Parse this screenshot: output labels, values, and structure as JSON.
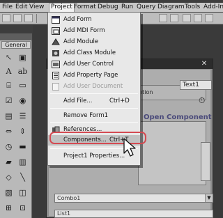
{
  "menubar": {
    "items": [
      {
        "label": "File"
      },
      {
        "label": "Edit"
      },
      {
        "label": "View"
      },
      {
        "label": "Project"
      },
      {
        "label": "Format"
      },
      {
        "label": "Debug"
      },
      {
        "label": "Run"
      },
      {
        "label": "Query"
      },
      {
        "label": "Diagram"
      },
      {
        "label": "Tools"
      },
      {
        "label": "Add-Ins"
      }
    ],
    "active": "Project"
  },
  "toolbox": {
    "tab_label": "General"
  },
  "form": {
    "text1": "Text1",
    "option_label": "ption",
    "heading": "Open Component",
    "combo1": "Combo1",
    "list1": "List1"
  },
  "project_menu": {
    "items": [
      {
        "label": "Add Form",
        "icon": "form-icon"
      },
      {
        "label": "Add MDI Form",
        "icon": "mdi-form-icon"
      },
      {
        "label": "Add Module",
        "icon": "module-icon"
      },
      {
        "label": "Add Class Module",
        "icon": "class-module-icon"
      },
      {
        "label": "Add User Control",
        "icon": "user-control-icon"
      },
      {
        "label": "Add Property Page",
        "icon": "property-page-icon"
      },
      {
        "label": "Add User Document",
        "icon": "user-document-icon",
        "disabled": true
      },
      {
        "label": "Add File...",
        "shortcut": "Ctrl+D"
      },
      {
        "label": "Remove Form1"
      },
      {
        "label": "References...",
        "icon": "references-icon"
      },
      {
        "label": "Components...",
        "shortcut": "Ctrl+T",
        "highlighted": true
      },
      {
        "label": "Project1 Properties..."
      }
    ]
  },
  "colors": {
    "highlight_ring": "#d44a52",
    "menu_bg": "#e8e8e8",
    "workspace_bg": "#3a3a3a"
  }
}
